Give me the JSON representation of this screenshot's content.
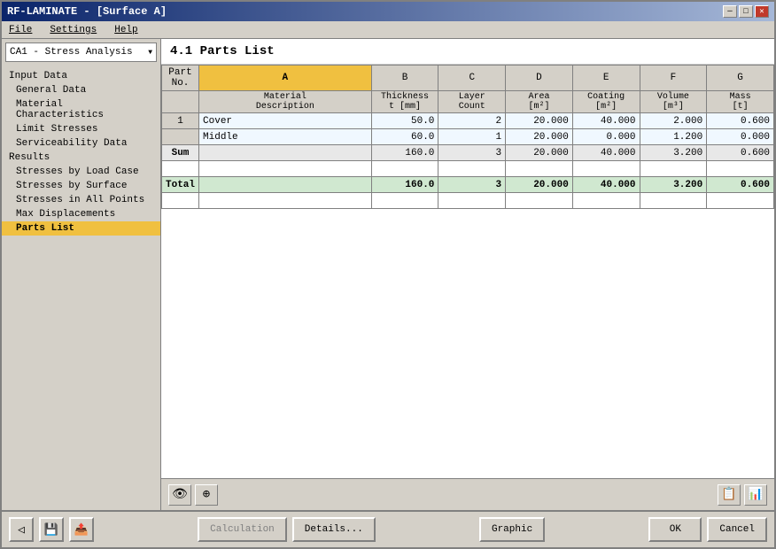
{
  "window": {
    "title": "RF-LAMINATE - [Surface A]",
    "close_label": "✕",
    "minimize_label": "─",
    "maximize_label": "□"
  },
  "menu": {
    "items": [
      {
        "label": "File"
      },
      {
        "label": "Settings"
      },
      {
        "label": "Help"
      }
    ]
  },
  "sidebar": {
    "dropdown": {
      "value": "CA1 - Stress Analysis"
    },
    "sections": [
      {
        "label": "Input Data",
        "items": [
          {
            "label": "General Data",
            "active": false
          },
          {
            "label": "Material Characteristics",
            "active": false
          },
          {
            "label": "Limit Stresses",
            "active": false
          },
          {
            "label": "Serviceability Data",
            "active": false
          }
        ]
      },
      {
        "label": "Results",
        "items": [
          {
            "label": "Stresses by Load Case",
            "active": false
          },
          {
            "label": "Stresses by Surface",
            "active": false
          },
          {
            "label": "Stresses in All Points",
            "active": false
          },
          {
            "label": "Max Displacements",
            "active": false
          },
          {
            "label": "Parts List",
            "active": true
          }
        ]
      }
    ]
  },
  "content": {
    "title": "4.1 Parts List",
    "table": {
      "columns": {
        "headers": [
          "A",
          "B",
          "C",
          "D",
          "E",
          "F",
          "G"
        ],
        "sub_headers": [
          "Material\nDescription",
          "Thickness\nt [mm]",
          "Layer\nCount",
          "Area\n[m²]",
          "Coating\n[m²]",
          "Volume\n[m³]",
          "Mass\n[t]"
        ]
      },
      "rows": [
        {
          "part_no": "1",
          "label": "",
          "col_a": "Cover",
          "col_b": "50.0",
          "col_c": "2",
          "col_d": "20.000",
          "col_e": "40.000",
          "col_f": "2.000",
          "col_g": "0.600",
          "type": "data"
        },
        {
          "part_no": "",
          "label": "",
          "col_a": "Middle",
          "col_b": "60.0",
          "col_c": "1",
          "col_d": "20.000",
          "col_e": "0.000",
          "col_f": "1.200",
          "col_g": "0.000",
          "type": "data"
        },
        {
          "part_no": "",
          "label": "Sum",
          "col_a": "",
          "col_b": "160.0",
          "col_c": "3",
          "col_d": "20.000",
          "col_e": "40.000",
          "col_f": "3.200",
          "col_g": "0.600",
          "type": "sum"
        },
        {
          "part_no": "",
          "label": "Total",
          "col_a": "",
          "col_b": "160.0",
          "col_c": "3",
          "col_d": "20.000",
          "col_e": "40.000",
          "col_f": "3.200",
          "col_g": "0.600",
          "type": "total"
        }
      ]
    }
  },
  "bottom_buttons": {
    "back_icon": "◁",
    "save_icon": "💾",
    "export_icon": "📤",
    "calculation_label": "Calculation",
    "details_label": "Details...",
    "graphic_label": "Graphic",
    "ok_label": "OK",
    "cancel_label": "Cancel"
  },
  "table_toolbar": {
    "eye_icon": "👁",
    "cursor_icon": "⊕",
    "export1_icon": "📋",
    "export2_icon": "📊"
  }
}
